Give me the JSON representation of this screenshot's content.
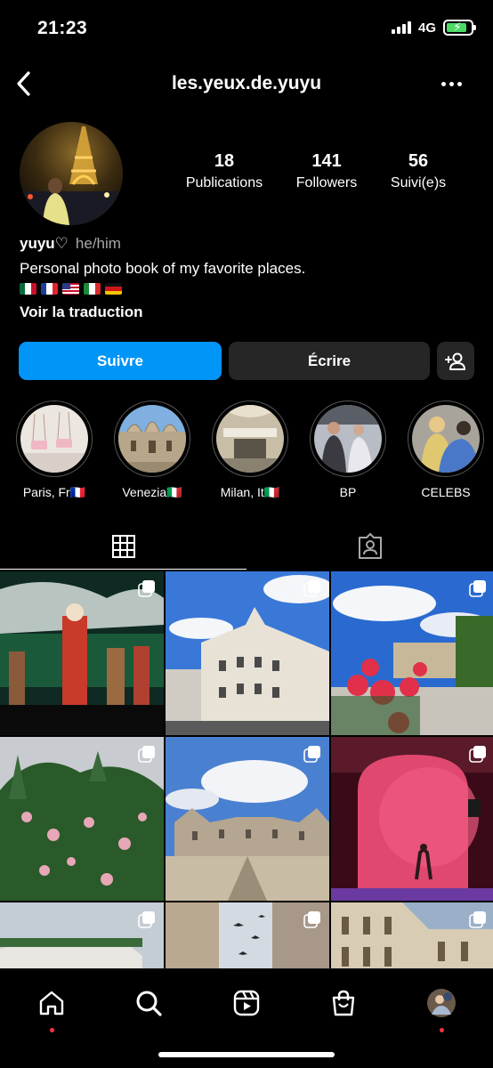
{
  "status_bar": {
    "time": "21:23",
    "network": "4G",
    "battery_icon": "battery-charging-icon"
  },
  "header": {
    "username": "les.yeux.de.yuyu",
    "back_icon": "back-chevron-icon",
    "more_icon": "more-dots-icon"
  },
  "profile": {
    "stats": [
      {
        "value": "18",
        "label": "Publications"
      },
      {
        "value": "141",
        "label": "Followers"
      },
      {
        "value": "56",
        "label": "Suivi(e)s"
      }
    ],
    "name": "yuyu♡",
    "pronouns": "he/him",
    "bio": "Personal photo book of my favorite places.",
    "flags": [
      "mexico-flag-icon",
      "france-flag-icon",
      "usa-flag-icon",
      "italy-flag-icon",
      "germany-flag-icon"
    ],
    "translate_link": "Voir la traduction"
  },
  "actions": {
    "follow": "Suivre",
    "message": "Écrire",
    "add_user_icon": "add-user-icon"
  },
  "highlights": [
    {
      "label": "Paris, Fr🇫🇷"
    },
    {
      "label": "Venezia🇮🇹"
    },
    {
      "label": "Milan, It🇮🇹"
    },
    {
      "label": "BP"
    },
    {
      "label": "CELEBS"
    }
  ],
  "tabs": [
    {
      "icon": "grid-icon",
      "active": true
    },
    {
      "icon": "tagged-person-icon",
      "active": false
    }
  ],
  "posts_count_visible": 9,
  "bottom_nav": [
    "home-icon",
    "search-icon",
    "reels-icon",
    "shop-icon",
    "profile-avatar"
  ],
  "colors": {
    "follow_button": "#0095f6",
    "secondary_button": "#262626",
    "notification_dot": "#ff3040",
    "background": "#000000"
  }
}
